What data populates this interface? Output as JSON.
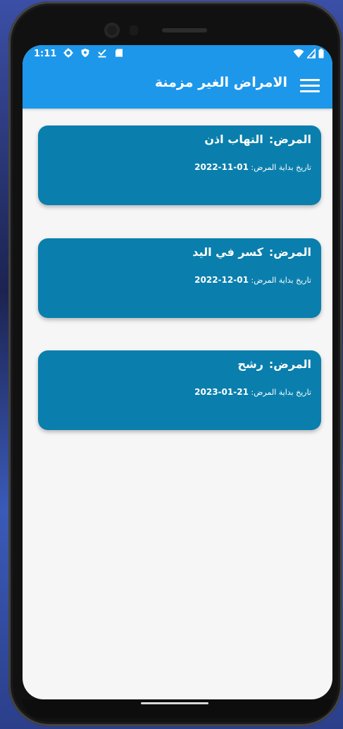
{
  "status_bar": {
    "time": "1:11",
    "icons": [
      "gear-icon",
      "shield-icon",
      "download-done-icon",
      "sd-card-icon"
    ],
    "right_icons": [
      "wifi-icon",
      "signal-icon",
      "battery-icon"
    ]
  },
  "app_bar": {
    "title": "الامراض الغير مزمنة",
    "menu_icon": "menu-icon"
  },
  "colors": {
    "accent": "#1d97ea",
    "card": "#0a7fad",
    "background": "#f6f6f6"
  },
  "diseases": [
    {
      "label": "المرض:",
      "name": "التهاب اذن",
      "date_label": "تاريخ بداية المرض:",
      "date": "01-11-2022"
    },
    {
      "label": "المرض:",
      "name": "كسر في اليد",
      "date_label": "تاريخ بداية المرض:",
      "date": "01-12-2022"
    },
    {
      "label": "المرض:",
      "name": "رشح",
      "date_label": "تاريخ بداية المرض:",
      "date": "21-01-2023"
    }
  ]
}
